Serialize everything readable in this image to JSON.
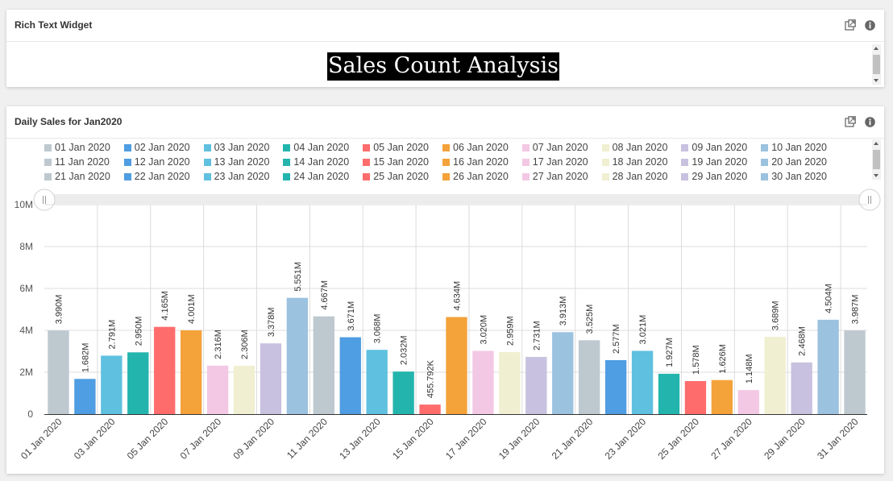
{
  "rich_text_widget": {
    "title": "Rich Text Widget",
    "content": "Sales Count Analysis"
  },
  "sales_widget": {
    "title": "Daily Sales for Jan2020"
  },
  "icons": {
    "expand": "expand-icon",
    "info": "info-icon"
  },
  "chart_data": {
    "type": "bar",
    "categories": [
      "01 Jan 2020",
      "02 Jan 2020",
      "03 Jan 2020",
      "04 Jan 2020",
      "05 Jan 2020",
      "06 Jan 2020",
      "07 Jan 2020",
      "08 Jan 2020",
      "09 Jan 2020",
      "10 Jan 2020",
      "11 Jan 2020",
      "12 Jan 2020",
      "13 Jan 2020",
      "14 Jan 2020",
      "15 Jan 2020",
      "16 Jan 2020",
      "17 Jan 2020",
      "18 Jan 2020",
      "19 Jan 2020",
      "20 Jan 2020",
      "21 Jan 2020",
      "22 Jan 2020",
      "23 Jan 2020",
      "24 Jan 2020",
      "25 Jan 2020",
      "26 Jan 2020",
      "27 Jan 2020",
      "28 Jan 2020",
      "29 Jan 2020",
      "30 Jan 2020",
      "31 Jan 2020"
    ],
    "values": [
      3990000,
      1682000,
      2791000,
      2950000,
      4165000,
      4001000,
      2316000,
      2306000,
      3378000,
      5551000,
      4667000,
      3671000,
      3068000,
      2032000,
      455792,
      4634000,
      3020000,
      2959000,
      2731000,
      3913000,
      3525000,
      2577000,
      3021000,
      1927000,
      1578000,
      1626000,
      1148000,
      3689000,
      2468000,
      4504000,
      3987000
    ],
    "data_labels": [
      "3.990M",
      "1.682M",
      "2.791M",
      "2.950M",
      "4.165M",
      "4.001M",
      "2.316M",
      "2.306M",
      "3.378M",
      "5.551M",
      "4.667M",
      "3.671M",
      "3.068M",
      "2.032M",
      "455.792K",
      "4.634M",
      "3.020M",
      "2.959M",
      "2.731M",
      "3.913M",
      "3.525M",
      "2.577M",
      "3.021M",
      "1.927M",
      "1.578M",
      "1.626M",
      "1.148M",
      "3.689M",
      "2.468M",
      "4.504M",
      "3.987M"
    ],
    "x_tick_labels": [
      "01 Jan 2020",
      "03 Jan 2020",
      "05 Jan 2020",
      "07 Jan 2020",
      "09 Jan 2020",
      "11 Jan 2020",
      "13 Jan 2020",
      "15 Jan 2020",
      "17 Jan 2020",
      "19 Jan 2020",
      "21 Jan 2020",
      "23 Jan 2020",
      "25 Jan 2020",
      "27 Jan 2020",
      "29 Jan 2020",
      "31 Jan 2020"
    ],
    "y_tick_labels": [
      "0",
      "2M",
      "4M",
      "6M",
      "8M",
      "10M"
    ],
    "ylim": [
      0,
      10000000
    ],
    "grid": true,
    "legend": "top",
    "legend_visible_rows": 3,
    "palette": [
      "#bec8cf",
      "#4f9de2",
      "#5fc0df",
      "#23b5ad",
      "#fe6c6c",
      "#f4a23a",
      "#f3c8e4",
      "#f0efd1",
      "#c8c1df",
      "#9bc2df"
    ]
  }
}
